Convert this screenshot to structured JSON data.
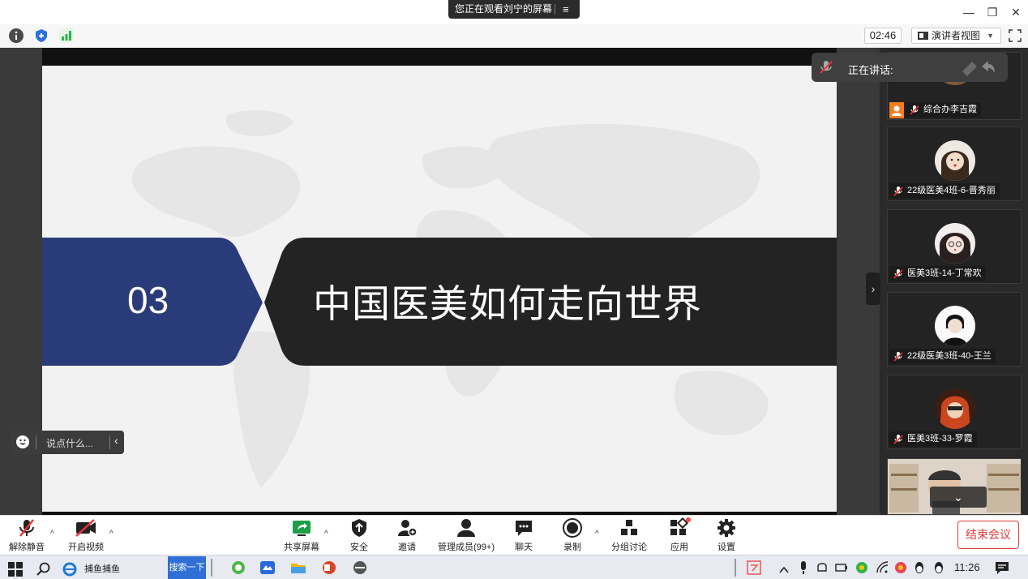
{
  "window": {
    "viewing_label": "您正在观看刘宁的屏幕",
    "menu_icon": "≡",
    "minimize": "—",
    "restore": "❐",
    "close": "✕"
  },
  "toolbar_top": {
    "timer": "02:46",
    "view_mode": "演讲者视图",
    "caret": "▼",
    "info_icon": "info-icon",
    "shield_icon": "shield-icon",
    "signal_icon": "signal-icon"
  },
  "slide": {
    "number": "03",
    "title": "中国医美如何走向世界",
    "colors": {
      "navy": "#2a3b7a",
      "dark": "#232323",
      "bg": "#f2f2f2"
    }
  },
  "chat": {
    "placeholder": "说点什么...",
    "chevron": "‹"
  },
  "panel": {
    "speaking_label": "正在讲话:",
    "collapse": "›",
    "participants": [
      {
        "name": "综合办李吉霞"
      },
      {
        "name": "22级医美4班-6-晋秀丽"
      },
      {
        "name": "医美3班-14-丁常欢"
      },
      {
        "name": "22级医美3班-40-王兰"
      },
      {
        "name": "医美3班-33-罗霞"
      },
      {
        "name": ""
      }
    ],
    "scroll_down": "⌄"
  },
  "bottombar": {
    "unmute": "解除静音",
    "start_video": "开启视频",
    "share_screen": "共享屏幕",
    "security": "安全",
    "invite": "邀请",
    "manage_members": "管理成员(99+)",
    "chat": "聊天",
    "record": "录制",
    "breakout": "分组讨论",
    "apps": "应用",
    "settings": "设置",
    "end_meeting": "结束会议",
    "caret": "^"
  },
  "taskbar": {
    "browser_label": "捕鱼捕鱼",
    "search_button": "搜索一下",
    "time": "11:26"
  }
}
